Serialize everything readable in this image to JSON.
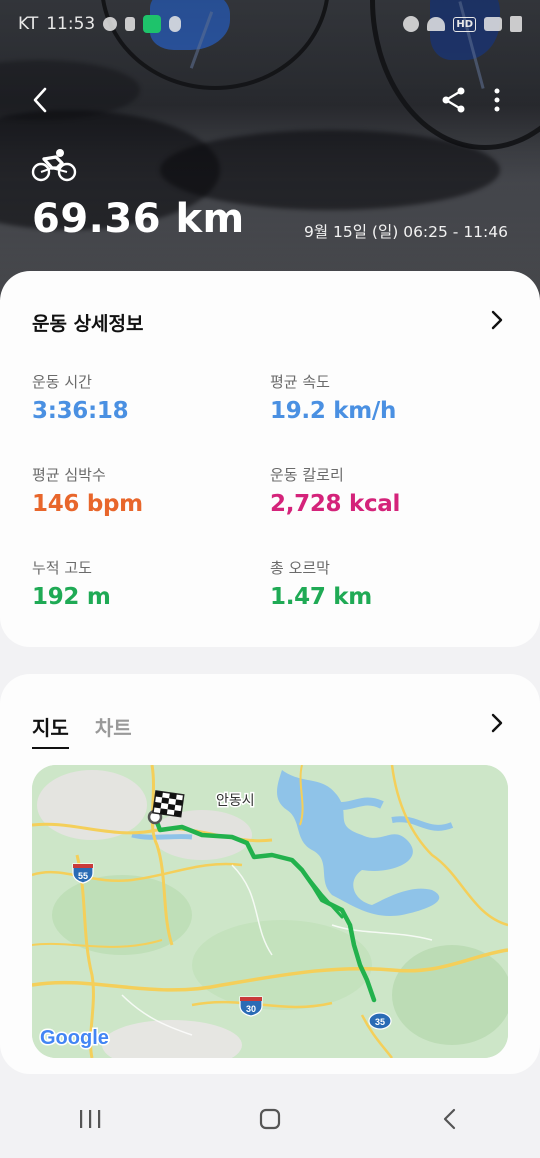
{
  "status_bar": {
    "carrier": "KT",
    "time": "11:53",
    "signal_text": "HD"
  },
  "header": {
    "back_icon": "chevron-left-icon",
    "share_icon": "share-icon",
    "more_icon": "more-vertical-icon",
    "activity_icon": "cycling-icon",
    "distance": "69.36 km",
    "datetime": "9월 15일 (일) 06:25 - 11:46"
  },
  "details": {
    "title": "운동 상세정보",
    "stats": [
      {
        "label": "운동 시간",
        "value": "3:36:18",
        "color": "#4a90e2"
      },
      {
        "label": "평균 속도",
        "value": "19.2 km/h",
        "color": "#4a90e2"
      },
      {
        "label": "평균 심박수",
        "value": "146 bpm",
        "color": "#e8662b"
      },
      {
        "label": "운동 칼로리",
        "value": "2,728 kcal",
        "color": "#d4237a"
      },
      {
        "label": "누적 고도",
        "value": "192 m",
        "color": "#1faa55"
      },
      {
        "label": "총 오르막",
        "value": "1.47 km",
        "color": "#1faa55"
      }
    ]
  },
  "map_section": {
    "tabs": [
      {
        "label": "지도",
        "active": true
      },
      {
        "label": "차트",
        "active": false
      }
    ],
    "city_label": "안동시",
    "road_labels": [
      "55",
      "30",
      "35"
    ],
    "map_logo": "Google",
    "route_color": "#22b14c"
  },
  "nav_bar": {
    "recents_icon": "recent-apps-icon",
    "home_icon": "home-icon",
    "back_icon": "back-icon"
  }
}
